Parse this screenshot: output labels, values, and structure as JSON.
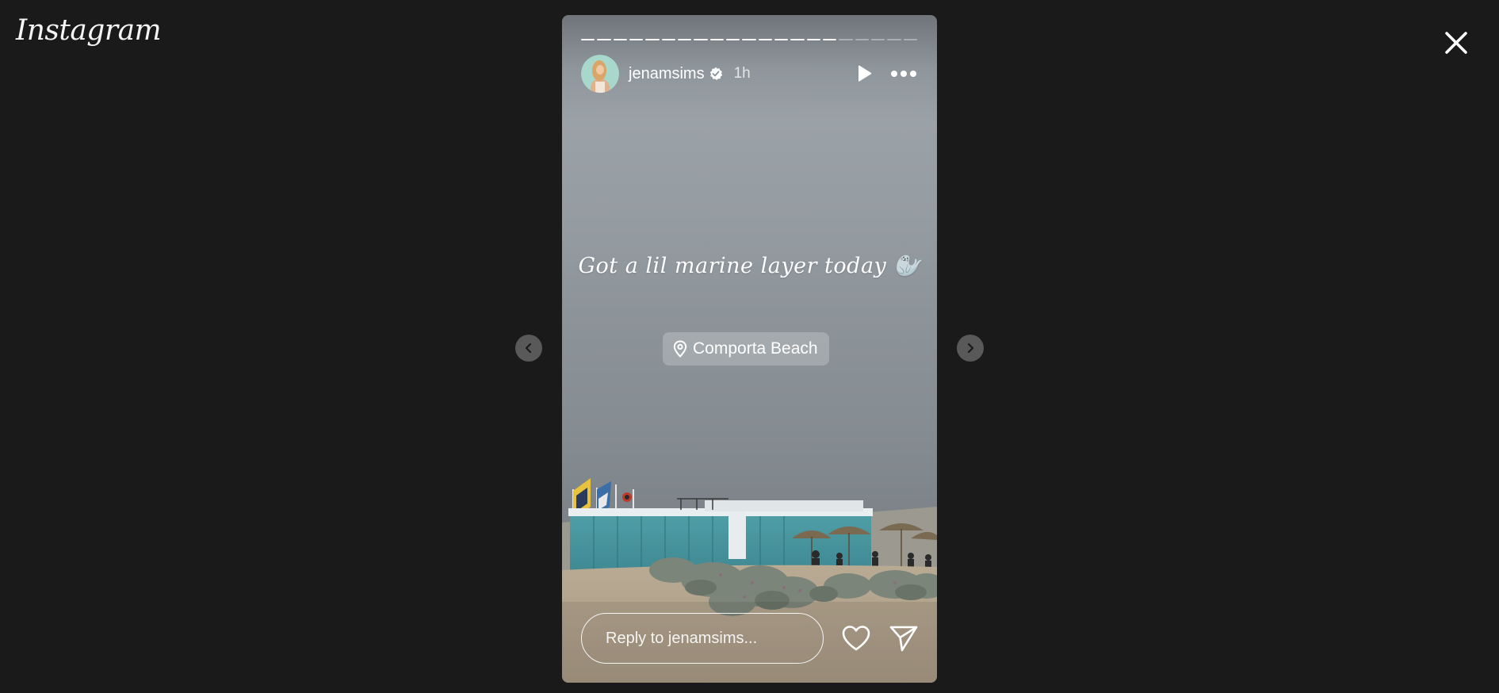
{
  "app": {
    "logo_text": "Instagram"
  },
  "story": {
    "username": "jenamsims",
    "timestamp": "1h",
    "caption": "Got a lil marine layer today 🦭",
    "location": "Comporta Beach",
    "progress_segments_total": 21,
    "progress_segments_seen": 16
  },
  "reply": {
    "placeholder": "Reply to jenamsims..."
  },
  "icons": {
    "close": "close-icon",
    "prev": "chevron-left-icon",
    "next": "chevron-right-icon",
    "play": "play-icon",
    "more": "more-icon",
    "verified": "verified-badge-icon",
    "location": "location-pin-icon",
    "like": "heart-icon",
    "share": "send-icon"
  },
  "colors": {
    "background": "#1a1a1a",
    "verified_badge": "#ffffff"
  }
}
